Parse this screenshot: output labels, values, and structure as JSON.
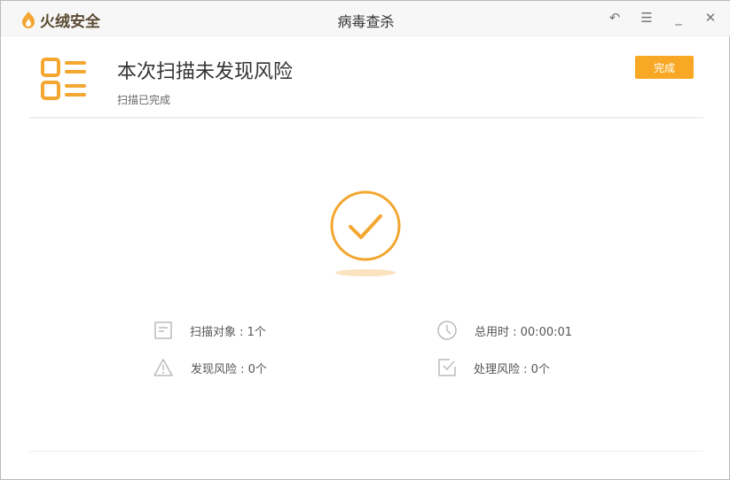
{
  "app": {
    "name": "火绒安全",
    "window_title": "病毒查杀"
  },
  "controls": {
    "back": "back-icon",
    "menu": "menu-icon",
    "minimize": "minimize-icon",
    "close": "close-icon"
  },
  "header": {
    "title": "本次扫描未发现风险",
    "subtitle": "扫描已完成",
    "done_label": "完成"
  },
  "stats": [
    {
      "label": "扫描对象 : 1个",
      "icon": "document-icon"
    },
    {
      "label": "总用时 : 00:00:01",
      "icon": "clock-icon"
    },
    {
      "label": "发现风险 : 0个",
      "icon": "warning-icon"
    },
    {
      "label": "处理风险 : 0个",
      "icon": "checkbox-icon"
    }
  ],
  "colors": {
    "accent": "#f9a825"
  }
}
